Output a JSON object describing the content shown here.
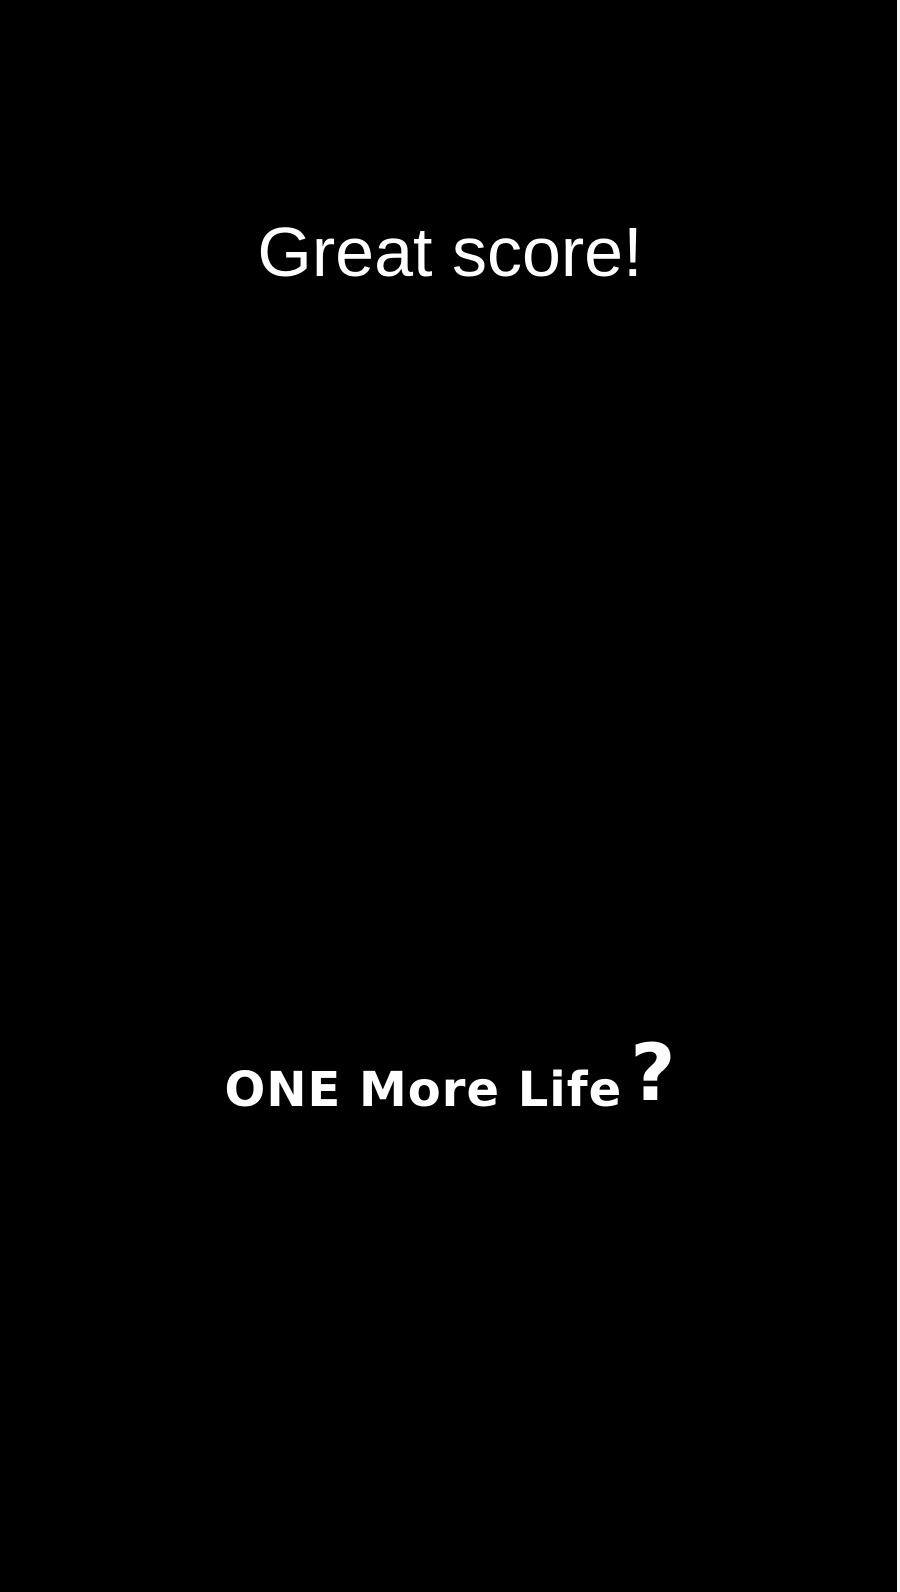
{
  "screen": {
    "background_color": "#000000",
    "text_color": "#ffffff"
  },
  "result": {
    "headline": "Great score!"
  },
  "continue_prompt": {
    "label": "ONE More Life",
    "mark": "?"
  }
}
